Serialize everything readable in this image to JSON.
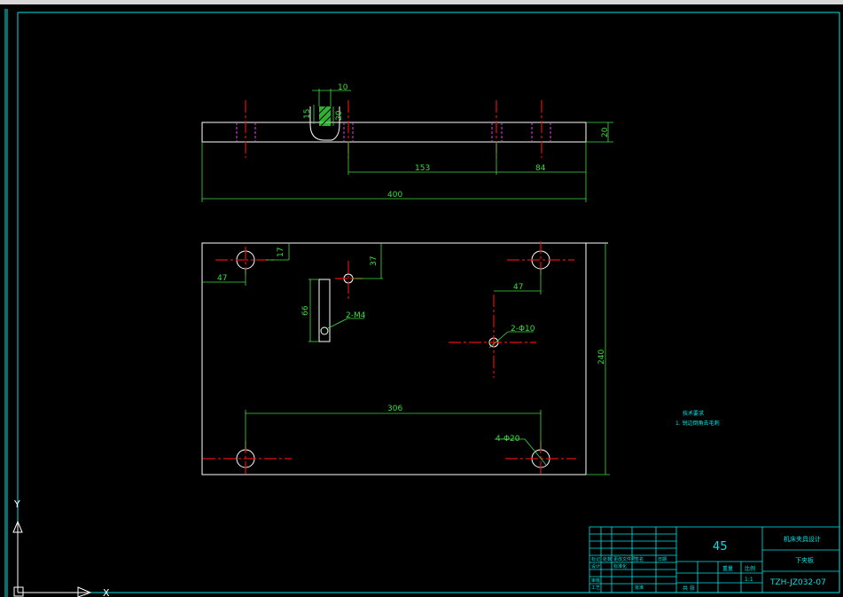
{
  "drawing": {
    "top_view": {
      "dim_slot_width": "10",
      "dim_slot_depth": "20",
      "dim_slot_offset": "15",
      "dim_thickness": "20",
      "dim_hole_spacing": "153",
      "dim_hole_edge": "84",
      "dim_length": "400"
    },
    "plan_view": {
      "dim_hole_top": "17",
      "dim_hole_left": "47",
      "dim_tap_top": "37",
      "dim_slot_length": "66",
      "label_tap": "2-M4",
      "dim_center_offset": "47",
      "label_center_hole": "2-Φ10",
      "dim_hole_span": "306",
      "label_corner_holes": "4-Φ20",
      "dim_width": "240"
    },
    "notes": {
      "title": "技术要求",
      "line1": "1. 锐边倒角去毛刺"
    }
  },
  "title_block": {
    "material": "45",
    "company": "机床夹具设计",
    "part_name": "下夹板",
    "drawing_no": "TZH-JZ032-07",
    "scale_label": "比例",
    "scale_value": "1:1",
    "sheet_label": "共 张",
    "weight_label": "重量",
    "small_cells": [
      "标记",
      "处数",
      "更改文件号",
      "签名",
      "日期",
      "设计",
      "标准化",
      "审核",
      "工艺",
      "批准"
    ]
  },
  "ucs": {
    "x_label": "X",
    "y_label": "Y"
  },
  "colors": {
    "background": "#000000",
    "outline": "#ffffff",
    "dimension": "#3fdc3f",
    "centerline": "#e01010",
    "hidden": "#e040e0",
    "border": "#00e5e5"
  }
}
